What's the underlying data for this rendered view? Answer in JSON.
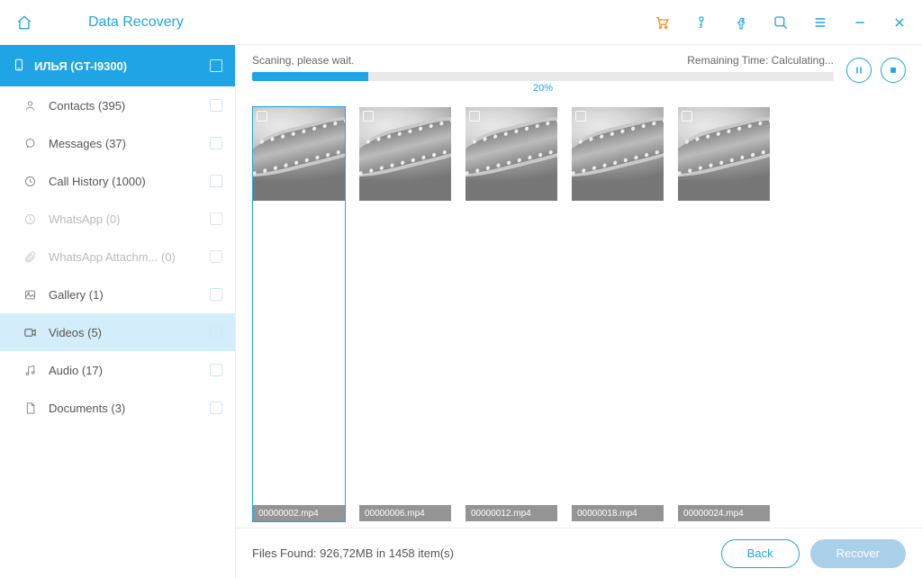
{
  "header": {
    "title": "Data Recovery"
  },
  "toolbar_icons": [
    "cart",
    "key",
    "facebook",
    "search",
    "menu",
    "minimize",
    "close"
  ],
  "device": {
    "label": "ИЛЬЯ (GT-I9300)"
  },
  "sidebar": [
    {
      "icon": "contacts",
      "label": "Contacts (395)",
      "disabled": false,
      "active": false
    },
    {
      "icon": "messages",
      "label": "Messages (37)",
      "disabled": false,
      "active": false
    },
    {
      "icon": "callhistory",
      "label": "Call History (1000)",
      "disabled": false,
      "active": false
    },
    {
      "icon": "whatsapp",
      "label": "WhatsApp (0)",
      "disabled": true,
      "active": false
    },
    {
      "icon": "attachment",
      "label": "WhatsApp Attachm...  (0)",
      "disabled": true,
      "active": false
    },
    {
      "icon": "gallery",
      "label": "Gallery (1)",
      "disabled": false,
      "active": false
    },
    {
      "icon": "videos",
      "label": "Videos (5)",
      "disabled": false,
      "active": true
    },
    {
      "icon": "audio",
      "label": "Audio (17)",
      "disabled": false,
      "active": false
    },
    {
      "icon": "documents",
      "label": "Documents (3)",
      "disabled": false,
      "active": false
    }
  ],
  "scan": {
    "status_text": "Scaning, please wait.",
    "remaining_label": "Remaining Time: Calculating...",
    "percent_text": "20%",
    "percent_value": 20
  },
  "files": [
    {
      "name": "00000002.mp4",
      "selected": true
    },
    {
      "name": "00000006.mp4",
      "selected": false
    },
    {
      "name": "00000012.mp4",
      "selected": false
    },
    {
      "name": "00000018.mp4",
      "selected": false
    },
    {
      "name": "00000024.mp4",
      "selected": false
    }
  ],
  "footer": {
    "status": "Files Found: 926,72MB in 1458 item(s)",
    "back_label": "Back",
    "recover_label": "Recover"
  },
  "colors": {
    "accent": "#1fa4e6",
    "accent_light": "#d4edfb"
  }
}
